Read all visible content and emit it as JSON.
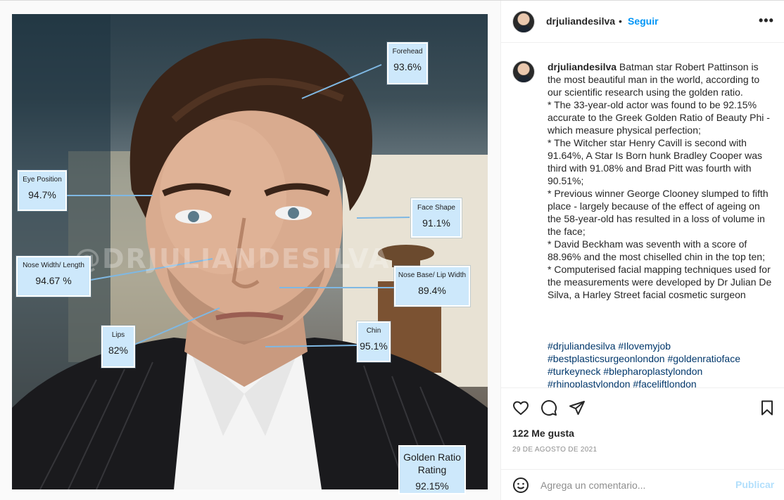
{
  "post": {
    "username": "drjuliandesilva",
    "separator": "•",
    "follow_label": "Seguir",
    "more_label": "•••",
    "watermark": "@DRJULIANDESILVA",
    "labels": [
      {
        "title": "Forehead",
        "value": "93.6%"
      },
      {
        "title": "Eye Position",
        "value": "94.7%"
      },
      {
        "title": "Face Shape",
        "value": "91.1%"
      },
      {
        "title": "Nose Width/ Length",
        "value": "94.67 %"
      },
      {
        "title": "Nose Base/ Lip Width",
        "value": "89.4%"
      },
      {
        "title": "Lips",
        "value": "82%"
      },
      {
        "title": "Chin",
        "value": "95.1%"
      }
    ],
    "rating": {
      "title": "Golden Ratio Rating",
      "value": "92.15%"
    }
  },
  "caption": {
    "username": "drjuliandesilva",
    "text": " Batman star Robert Pattinson is the most beautiful man in the world, according to our scientific research using the golden ratio.\n* The 33-year-old actor was found to be 92.15% accurate to the Greek Golden Ratio of Beauty Phi - which measure physical perfection;\n* The Witcher star Henry Cavill is second with 91.64%, A Star Is Born hunk Bradley Cooper was third with 91.08% and Brad Pitt was fourth with 90.51%;\n* Previous winner George Clooney slumped to fifth place - largely because of the effect of ageing on the 58-year-old has resulted in a loss of volume in the face;\n* David Beckham was seventh with a score of 88.96% and the most chiselled chin in the top ten;\n* Computerised facial mapping techniques used for the measurements were developed by Dr Julian De Silva, a Harley Street facial cosmetic surgeon",
    "hashtags": "#drjuliandesilva #Ilovemyjob\n#bestplasticsurgeonlondon #goldenratioface\n#turkeyneck #blepharoplastylondon\n#rhinoplastylondon #faceliftlondon"
  },
  "actions": {
    "icons": [
      "heart-icon",
      "comment-icon",
      "share-icon",
      "bookmark-icon",
      "emoji-icon"
    ],
    "likes": "122 Me gusta",
    "date": "29 DE AGOSTO DE 2021",
    "comment_placeholder": "Agrega un comentario...",
    "post_label": "Publicar"
  },
  "colors": {
    "accent": "#0095f6",
    "hashtag": "#00376b",
    "label_bg": "#cde8fb",
    "muted": "#8e8e8e",
    "post_disabled": "#b2dffc"
  }
}
